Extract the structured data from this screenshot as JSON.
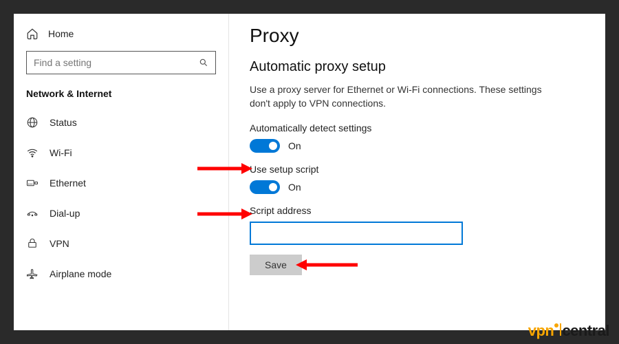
{
  "sidebar": {
    "home_label": "Home",
    "search_placeholder": "Find a setting",
    "category": "Network & Internet",
    "items": [
      {
        "label": "Status"
      },
      {
        "label": "Wi-Fi"
      },
      {
        "label": "Ethernet"
      },
      {
        "label": "Dial-up"
      },
      {
        "label": "VPN"
      },
      {
        "label": "Airplane mode"
      }
    ]
  },
  "main": {
    "title": "Proxy",
    "section_title": "Automatic proxy setup",
    "section_desc": "Use a proxy server for Ethernet or Wi-Fi connections. These settings don't apply to VPN connections.",
    "auto_detect": {
      "label": "Automatically detect settings",
      "state": "On"
    },
    "use_script": {
      "label": "Use setup script",
      "state": "On"
    },
    "script_address": {
      "label": "Script address",
      "value": ""
    },
    "save_label": "Save"
  },
  "watermark": {
    "left": "vpn",
    "right": "central"
  }
}
